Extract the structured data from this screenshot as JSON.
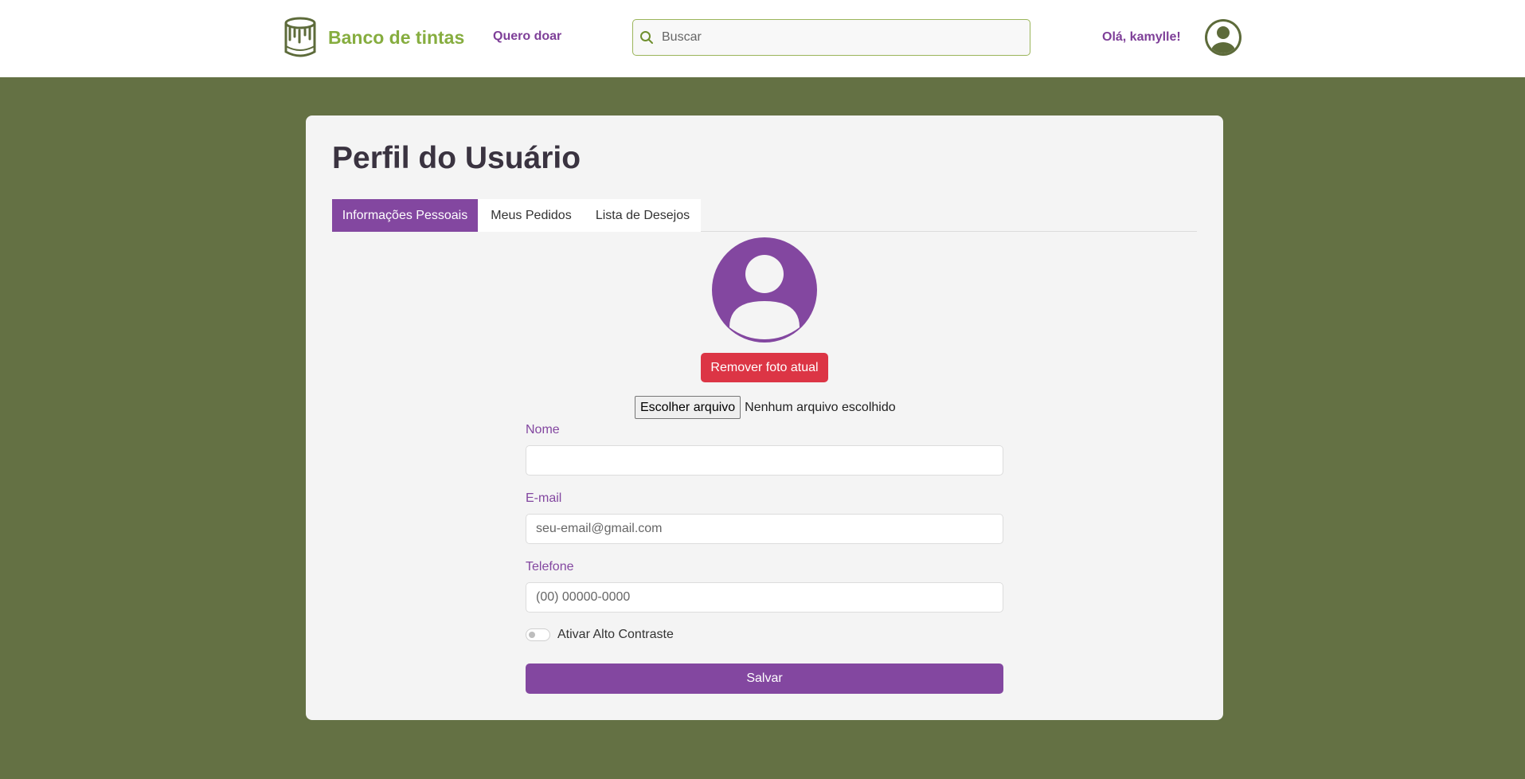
{
  "header": {
    "brand_name": "Banco de tintas",
    "logo_icon": "paint-bucket-icon",
    "donate_link": "Quero doar",
    "search": {
      "placeholder": "Buscar",
      "value": "",
      "icon": "search-icon"
    },
    "greeting": "Olá, kamylle!",
    "avatar_icon": "user-avatar-icon"
  },
  "profile": {
    "title": "Perfil do Usuário",
    "tabs": [
      {
        "label": "Informações Pessoais",
        "active": true
      },
      {
        "label": "Meus Pedidos",
        "active": false
      },
      {
        "label": "Lista de Desejos",
        "active": false
      }
    ],
    "avatar_icon": "user-avatar-icon",
    "remove_photo_label": "Remover foto atual",
    "file_input": {
      "button_label": "Escolher arquivo",
      "status": "Nenhum arquivo escolhido"
    },
    "fields": {
      "name": {
        "label": "Nome",
        "value": "",
        "placeholder": ""
      },
      "email": {
        "label": "E-mail",
        "value": "",
        "placeholder": "seu-email@gmail.com"
      },
      "phone": {
        "label": "Telefone",
        "value": "",
        "placeholder": "(00) 00000-0000"
      }
    },
    "high_contrast": {
      "label": "Ativar Alto Contraste",
      "enabled": false
    },
    "save_label": "Salvar"
  },
  "colors": {
    "page_background": "#647144",
    "brand_green": "#86ad3f",
    "accent_purple": "#8347a0",
    "danger_red": "#dc3545",
    "card_background": "#f4f4f4"
  }
}
